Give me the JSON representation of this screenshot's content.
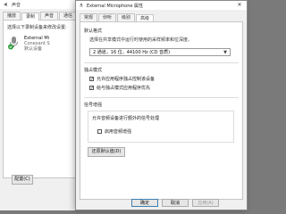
{
  "back_window": {
    "title": "声音",
    "tabs": [
      "播放",
      "录制",
      "声音",
      "通信"
    ],
    "active_tab": 1,
    "hint": "选择以下录制设备来修改设置:",
    "device": {
      "name": "External Mi",
      "sub1": "Conexant S",
      "sub2": "默认设备"
    },
    "configure_label": "配置(C)"
  },
  "front_window": {
    "title": "External Microphone 属性",
    "tabs": [
      "常规",
      "侦听",
      "级别",
      "高级"
    ],
    "active_tab": 3,
    "default_format": {
      "title": "默认格式",
      "desc": "选择在共享模式中运行时使用的采样频率和位深度。",
      "selected": "2 通道，16 位，44100 Hz (CD 音质)"
    },
    "exclusive_mode": {
      "title": "独占模式",
      "options": [
        {
          "label": "允许应用程序独占控制该设备",
          "checked": true
        },
        {
          "label": "给与独占模式应用程序优先",
          "checked": true
        }
      ]
    },
    "signal_enhancements": {
      "title": "信号增强",
      "desc": "允许音频设备进行额外的信号处理",
      "option": {
        "label": "启用音频增强",
        "checked": false
      }
    },
    "restore_label": "还原默认值(D)",
    "buttons": {
      "ok": "确定",
      "cancel": "取消",
      "apply": "应用(A)"
    }
  },
  "colors": {
    "background": "#7a7a7a",
    "window": "#f0f0f0",
    "panel": "#ffffff",
    "mic_check": "#2e9e3e"
  }
}
